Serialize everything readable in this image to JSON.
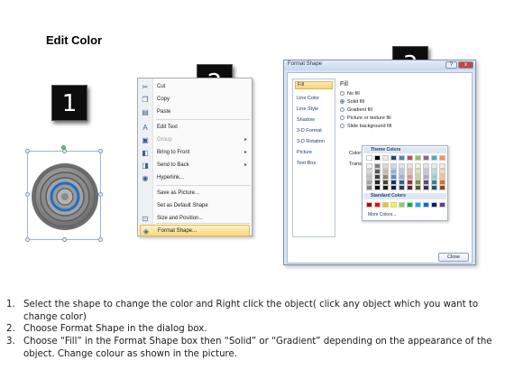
{
  "title": "Edit Color",
  "badges": [
    "1",
    "2",
    "3"
  ],
  "context_menu": {
    "items": [
      {
        "label": "Cut",
        "icon": "scissors-icon",
        "glyph": "✂"
      },
      {
        "label": "Copy",
        "icon": "copy-icon",
        "glyph": "❐"
      },
      {
        "label": "Paste",
        "icon": "paste-icon",
        "glyph": "▤"
      },
      {
        "label": "Edit Text",
        "icon": "edit-text-icon",
        "glyph": "A"
      },
      {
        "label": "Group",
        "icon": "group-icon",
        "glyph": "▣",
        "disabled": true,
        "submenu": true
      },
      {
        "label": "Bring to Front",
        "icon": "bring-front-icon",
        "glyph": "◧",
        "submenu": true
      },
      {
        "label": "Send to Back",
        "icon": "send-back-icon",
        "glyph": "◨",
        "submenu": true
      },
      {
        "label": "Hyperlink...",
        "icon": "hyperlink-icon",
        "glyph": "◉"
      },
      {
        "label": "Save as Picture...",
        "icon": "",
        "glyph": ""
      },
      {
        "label": "Set as Default Shape",
        "icon": "",
        "glyph": ""
      },
      {
        "label": "Size and Position...",
        "icon": "size-position-icon",
        "glyph": "⊡"
      },
      {
        "label": "Format Shape...",
        "icon": "format-shape-icon",
        "glyph": "◈",
        "highlighted": true
      }
    ]
  },
  "dialog": {
    "title": "Format Shape",
    "help": "?",
    "close_x": "x",
    "categories": [
      "Fill",
      "Line Color",
      "Line Style",
      "Shadow",
      "3-D Format",
      "3-D Rotation",
      "Picture",
      "Text Box"
    ],
    "selected_category": "Fill",
    "fill_heading": "Fill",
    "fill_options": [
      {
        "label": "No fill",
        "checked": false
      },
      {
        "label": "Solid fill",
        "checked": true
      },
      {
        "label": "Gradient fill",
        "checked": false
      },
      {
        "label": "Picture or texture fill",
        "checked": false
      },
      {
        "label": "Slide background fill",
        "checked": false
      }
    ],
    "color_label": "Color:",
    "transparency_label": "Transpa",
    "close_button": "Close"
  },
  "color_picker": {
    "theme_heading": "Theme Colors",
    "standard_heading": "Standard Colors",
    "more_colors": "More Colors...",
    "theme_top": [
      "#ffffff",
      "#000000",
      "#eeece1",
      "#1f497d",
      "#4f81bd",
      "#c0504d",
      "#9bbb59",
      "#8064a2",
      "#4bacc6",
      "#f79646"
    ],
    "theme_shades": [
      [
        "#f2f2f2",
        "#7f7f7f",
        "#ddd9c3",
        "#c6d9f0",
        "#dbe5f1",
        "#f2dcdb",
        "#ebf1dd",
        "#e5e0ec",
        "#dbeef3",
        "#fdeada"
      ],
      [
        "#d8d8d8",
        "#595959",
        "#c4bd97",
        "#8db3e2",
        "#b8cce4",
        "#e5b9b7",
        "#d7e3bc",
        "#ccc1d9",
        "#b7dde8",
        "#fbd5b5"
      ],
      [
        "#bfbfbf",
        "#3f3f3f",
        "#938953",
        "#548dd4",
        "#95b3d7",
        "#d99694",
        "#c3d69b",
        "#b2a2c7",
        "#92cddc",
        "#fac08f"
      ],
      [
        "#a5a5a5",
        "#262626",
        "#494429",
        "#17365d",
        "#366092",
        "#953734",
        "#76923c",
        "#5f497a",
        "#31859b",
        "#e36c09"
      ],
      [
        "#7f7f7f",
        "#0c0c0c",
        "#1d1b10",
        "#0f243e",
        "#244061",
        "#632423",
        "#4f6128",
        "#3f3151",
        "#205867",
        "#974806"
      ]
    ],
    "standard": [
      "#c00000",
      "#ff0000",
      "#ffc000",
      "#ffff00",
      "#92d050",
      "#00b050",
      "#00b0f0",
      "#0070c0",
      "#002060",
      "#7030a0"
    ]
  },
  "instructions": [
    {
      "num": "1.",
      "text": "Select the shape to change the color and Right click the object( click any object which you want to change color)"
    },
    {
      "num": "2.",
      "text": "Choose Format Shape in the dialog box."
    },
    {
      "num": "3.",
      "text": "Choose “Fill” in the Format Shape box then “Solid” or “Gradient” depending on the appearance of the object. Change colour as shown in the picture."
    }
  ]
}
